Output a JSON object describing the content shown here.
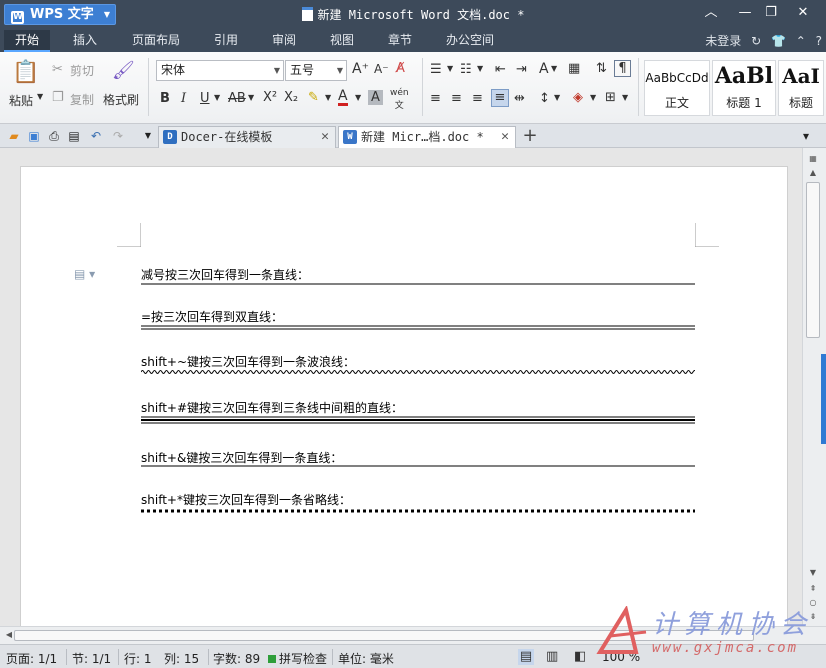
{
  "app": {
    "name": "WPS 文字",
    "window_title": "新建 Microsoft Word 文档.doc *",
    "window_buttons": [
      "minimize",
      "restore",
      "close"
    ]
  },
  "menu": {
    "tabs": [
      "开始",
      "插入",
      "页面布局",
      "引用",
      "审阅",
      "视图",
      "章节",
      "办公空间"
    ],
    "active_tab": "开始",
    "login": "未登录",
    "help": "?"
  },
  "ribbon": {
    "paste": "粘贴",
    "cut": "剪切",
    "copy": "复制",
    "format_painter": "格式刷",
    "font_name": "宋体",
    "font_size": "五号",
    "styles": [
      {
        "preview": "AaBbCcDd",
        "name": "正文"
      },
      {
        "preview": "AaBl",
        "name": "标题 1"
      },
      {
        "preview": "AaI",
        "name": "标题"
      }
    ]
  },
  "doc_tabs": [
    {
      "title": "Docer-在线模板",
      "active": false
    },
    {
      "title": "新建 Micr…档.doc *",
      "active": true
    }
  ],
  "document": {
    "lines": [
      {
        "text": "减号按三次回车得到一条直线：",
        "rule": "single"
      },
      {
        "text": "=按三次回车得到双直线：",
        "rule": "double"
      },
      {
        "text": "shift+~键按三次回车得到一条波浪线：",
        "rule": "wavy"
      },
      {
        "text": "shift+#键按三次回车得到三条线中间粗的直线：",
        "rule": "triple"
      },
      {
        "text": "shift+&键按三次回车得到一条直线：",
        "rule": "single"
      },
      {
        "text": "shift+*键按三次回车得到一条省略线：",
        "rule": "dotted"
      }
    ]
  },
  "status": {
    "page": "页面: 1/1",
    "section": "节: 1/1",
    "row": "行: 1",
    "col": "列: 15",
    "word_count": "字数: 89",
    "spell_check": "拼写检查",
    "unit": "单位: 毫米",
    "zoom": "100 %"
  },
  "watermark": {
    "text": "计算机协会",
    "url": "www.gxjmca.com"
  },
  "colors": {
    "titlebar": "#3d4a5a",
    "accent": "#3d7fd3",
    "scroll_indicator": "#2f7ad3"
  }
}
